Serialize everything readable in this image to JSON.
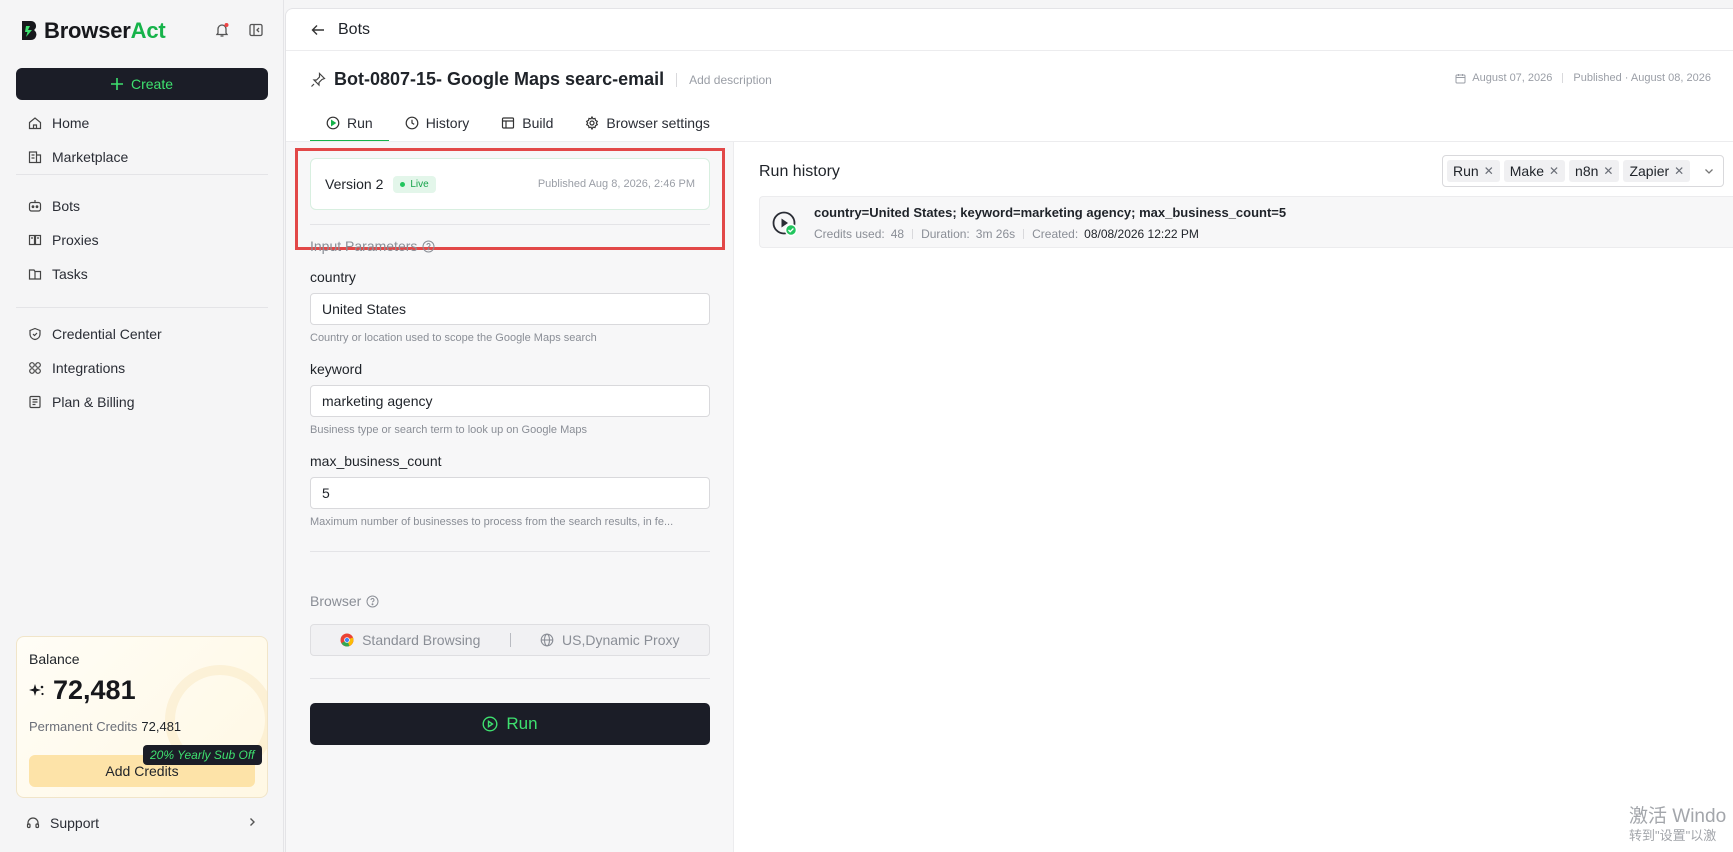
{
  "app": {
    "name_part1": "Browser",
    "name_part2": "Act"
  },
  "sidebar": {
    "create_label": "Create",
    "items": [
      {
        "label": "Home",
        "icon": "home-icon"
      },
      {
        "label": "Marketplace",
        "icon": "marketplace-icon"
      },
      {
        "label": "Bots",
        "icon": "bot-icon"
      },
      {
        "label": "Proxies",
        "icon": "proxies-icon"
      },
      {
        "label": "Tasks",
        "icon": "tasks-icon"
      },
      {
        "label": "Credential Center",
        "icon": "credential-icon"
      },
      {
        "label": "Integrations",
        "icon": "integrations-icon"
      },
      {
        "label": "Plan & Billing",
        "icon": "billing-icon"
      }
    ],
    "balance": {
      "title": "Balance",
      "amount": "72,481",
      "permanent_label": "Permanent Credits",
      "permanent_value": "72,481",
      "add_credits": "Add Credits",
      "promo": "20% Yearly Sub Off"
    },
    "support": "Support"
  },
  "header": {
    "back_label": "Bots",
    "bot_title": "Bot-0807-15- Google Maps searc-email",
    "add_description": "Add description",
    "created_date": "August 07, 2026",
    "published": "Published · August 08, 2026"
  },
  "tabs": [
    {
      "label": "Run",
      "active": true
    },
    {
      "label": "History",
      "active": false
    },
    {
      "label": "Build",
      "active": false
    },
    {
      "label": "Browser settings",
      "active": false
    }
  ],
  "version": {
    "name": "Version 2",
    "badge": "Live",
    "published": "Published Aug 8, 2026, 2:46 PM"
  },
  "input_parameters": {
    "title": "Input Parameters",
    "fields": [
      {
        "name": "country",
        "value": "United States",
        "hint": "Country or location used to scope the Google Maps search"
      },
      {
        "name": "keyword",
        "value": "marketing agency",
        "hint": "Business type or search term to look up on Google Maps"
      },
      {
        "name": "max_business_count",
        "value": "5",
        "hint": "Maximum number of businesses to process from the search results, in fe..."
      }
    ]
  },
  "browser": {
    "title": "Browser",
    "mode": "Standard Browsing",
    "proxy": "US,Dynamic Proxy"
  },
  "run_button": "Run",
  "run_history": {
    "title": "Run history",
    "filters": [
      "Run",
      "Make",
      "n8n",
      "Zapier"
    ],
    "runs": [
      {
        "params": "country=United States; keyword=marketing agency; max_business_count=5",
        "credits_label": "Credits used:",
        "credits": "48",
        "duration_label": "Duration:",
        "duration": "3m 26s",
        "created_label": "Created:",
        "created": "08/08/2026 12:22 PM"
      }
    ]
  },
  "watermark": {
    "line1": "激活 Windo",
    "line2": "转到\"设置\"以激"
  },
  "colors": {
    "accent": "#16b34a",
    "dark": "#1b1d27",
    "highlight": "#e24848"
  }
}
